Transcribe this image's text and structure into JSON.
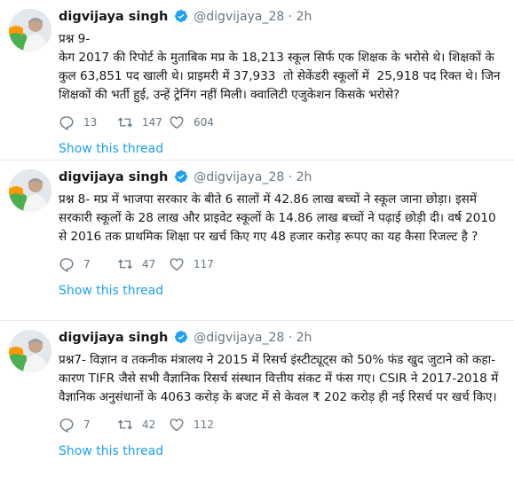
{
  "tweets": [
    {
      "name": "digvijaya singh",
      "handle": "@digvijaya_28",
      "dot": "·",
      "time": "2h",
      "text": "प्रश्न 9-\nकेग 2017 की रिपोर्ट के मुताबिक मप्र के 18,213 स्कूल सिर्फ एक शिक्षक के भरोसे थे। शिक्षकों के कुल 63,851 पद खाली थे। प्राइमरी में 37,933  तो सेकेंडरी स्कूलों में  25,918 पद रिक्त थे। जिन शिक्षकों की भर्ती हुई, उन्हें ट्रेनिंग नहीं मिली। क्वालिटी एजुकेशन किसके भरोसे?",
      "replies": "13",
      "retweets": "147",
      "likes": "604",
      "show_thread": "Show this thread"
    },
    {
      "name": "digvijaya singh",
      "handle": "@digvijaya_28",
      "dot": "·",
      "time": "2h",
      "text": "प्रश्न 8- मप्र में भाजपा सरकार के बीते 6 सालों में 42.86 लाख बच्चों ने स्कूल जाना छोड़ा। इसमें सरकारी स्कूलों के 28 लाख और प्राइवेट स्कूलों के 14.86 लाख बच्चों ने पढ़ाई छोड़ी दी। वर्ष 2010 से 2016 तक प्राथमिक शिक्षा पर खर्च किए गए 48 हजार करोड़ रूपए का यह कैसा रिजल्ट है ?",
      "replies": "7",
      "retweets": "47",
      "likes": "117",
      "show_thread": "Show this thread"
    },
    {
      "name": "digvijaya singh",
      "handle": "@digvijaya_28",
      "dot": "·",
      "time": "2h",
      "text": "प्रश्न7- विज्ञान व तकनीक मंत्रालय ने 2015 में रिसर्च इंस्टीट्यूट्स को 50% फंड खुद जुटाने को कहा-कारण TIFR जैसे सभी वैज्ञानिक रिसर्च संस्थान वित्तीय संकट में फंस गए। CSIR ने 2017-2018 में वैज्ञानिक अनुसंधानों के 4063 करोड़ के बजट में से केवल ₹ 202 करोड़ ही नई रिसर्च पर खर्च किए।",
      "replies": "7",
      "retweets": "42",
      "likes": "112",
      "show_thread": "Show this thread"
    }
  ],
  "colors": {
    "link": "#1da1f2",
    "muted": "#657786",
    "verified": "#1da1f2",
    "divider": "#e6ecf0"
  }
}
